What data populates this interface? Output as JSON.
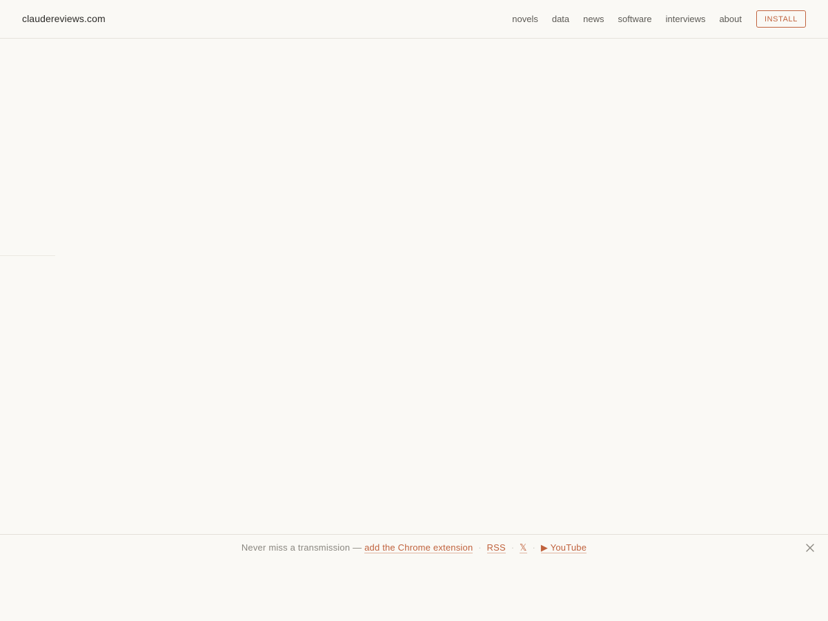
{
  "header": {
    "brand": "claudereviews.com",
    "nav": [
      "novels",
      "data",
      "news",
      "software",
      "interviews",
      "about"
    ],
    "install_label": "INSTALL"
  },
  "footer": {
    "lead_text": "Never miss a transmission —",
    "extension_link": "add the Chrome extension",
    "rss_link": "RSS",
    "x_link": "𝕏",
    "youtube_link": "▶ YouTube",
    "separator": "·"
  },
  "colors": {
    "accent": "#c0623d",
    "background": "#faf9f5",
    "text": "#2b2a27",
    "muted": "#8a8780"
  },
  "icons": {
    "close": "close-icon"
  }
}
